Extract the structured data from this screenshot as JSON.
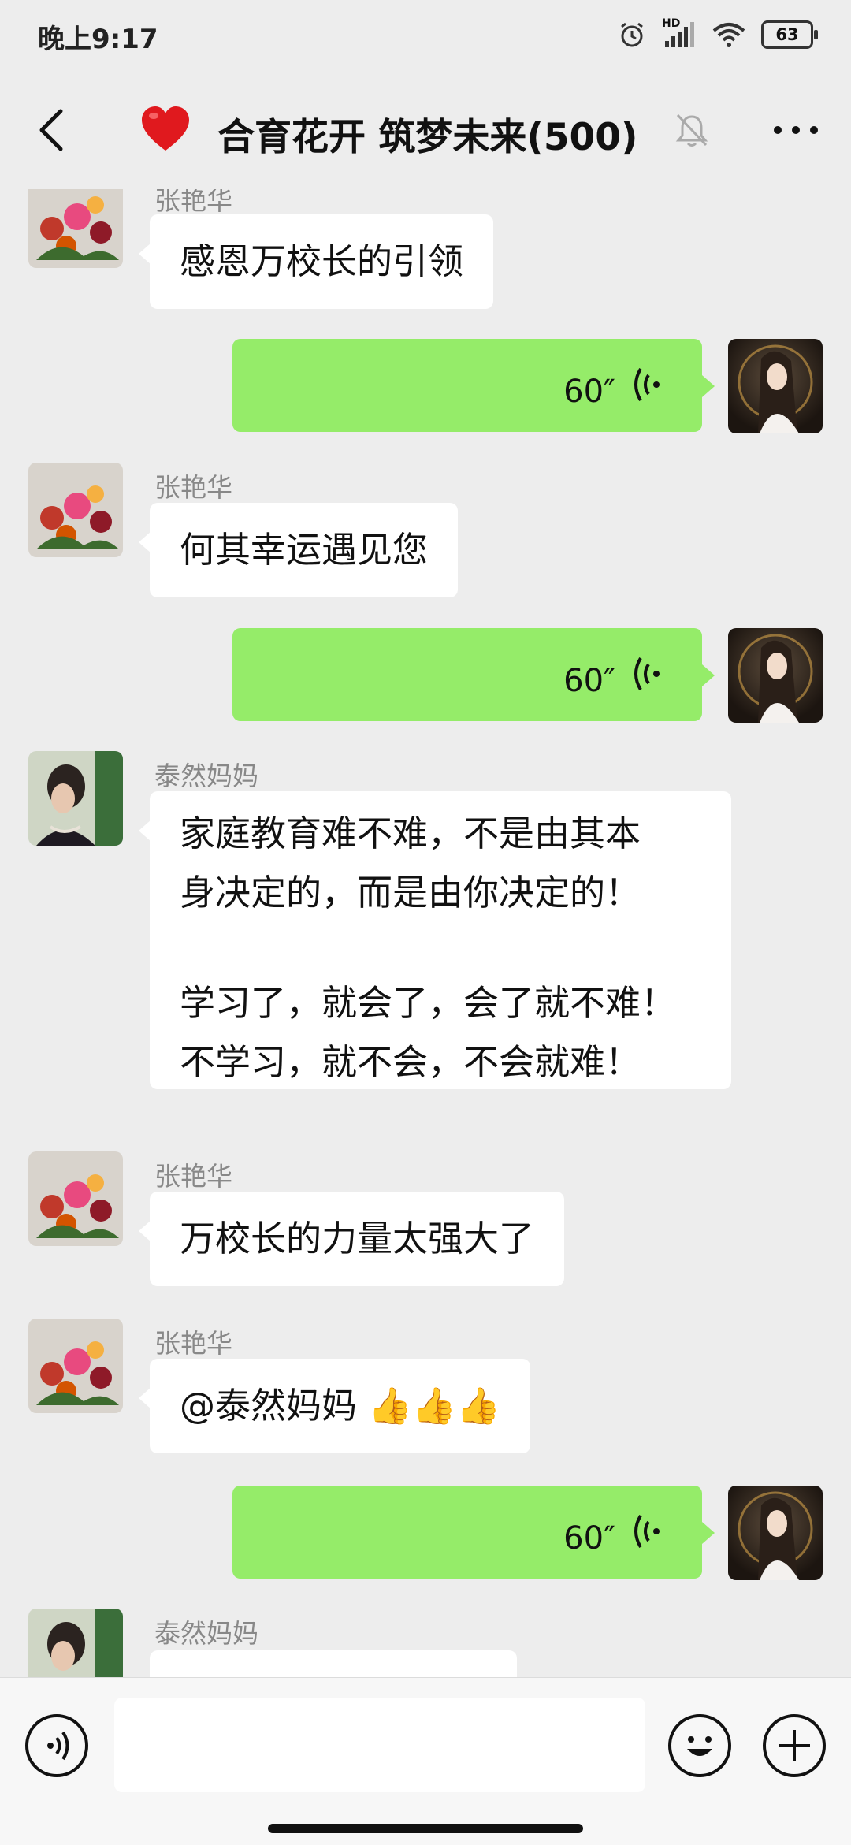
{
  "status_bar": {
    "time": "晚上9:17",
    "battery": "63",
    "hd_label": "HD"
  },
  "header": {
    "back_label": "<",
    "title": "合育花开 筑梦未来(500)",
    "more_label": "···",
    "icons": [
      "heart-icon",
      "mute-bell-icon"
    ]
  },
  "messages": [
    {
      "side": "left",
      "sender": "张艳华",
      "text": "感恩万校长的引领"
    },
    {
      "side": "right",
      "type": "voice",
      "duration": "60″"
    },
    {
      "side": "left",
      "sender": "张艳华",
      "text": "何其幸运遇见您"
    },
    {
      "side": "right",
      "type": "voice",
      "duration": "60″"
    },
    {
      "side": "left",
      "sender": "泰然妈妈",
      "lines": [
        "家庭教育难不难，不是由其本",
        "身决定的，而是由你决定的！",
        "",
        "学习了，就会了，会了就不难！",
        "不学习，就不会，不会就难！"
      ]
    },
    {
      "side": "left",
      "sender": "张艳华",
      "text": "万校长的力量太强大了"
    },
    {
      "side": "left",
      "sender": "张艳华",
      "text": "@泰然妈妈 ",
      "emoji": "👍👍👍"
    },
    {
      "side": "right",
      "type": "voice",
      "duration": "60″"
    },
    {
      "side": "left",
      "sender": "泰然妈妈",
      "text": ""
    }
  ],
  "input_bar": {
    "placeholder": ""
  },
  "colors": {
    "background": "#ededed",
    "my_bubble": "#95ec69",
    "their_bubble": "#ffffff",
    "sender_name": "#888888"
  }
}
